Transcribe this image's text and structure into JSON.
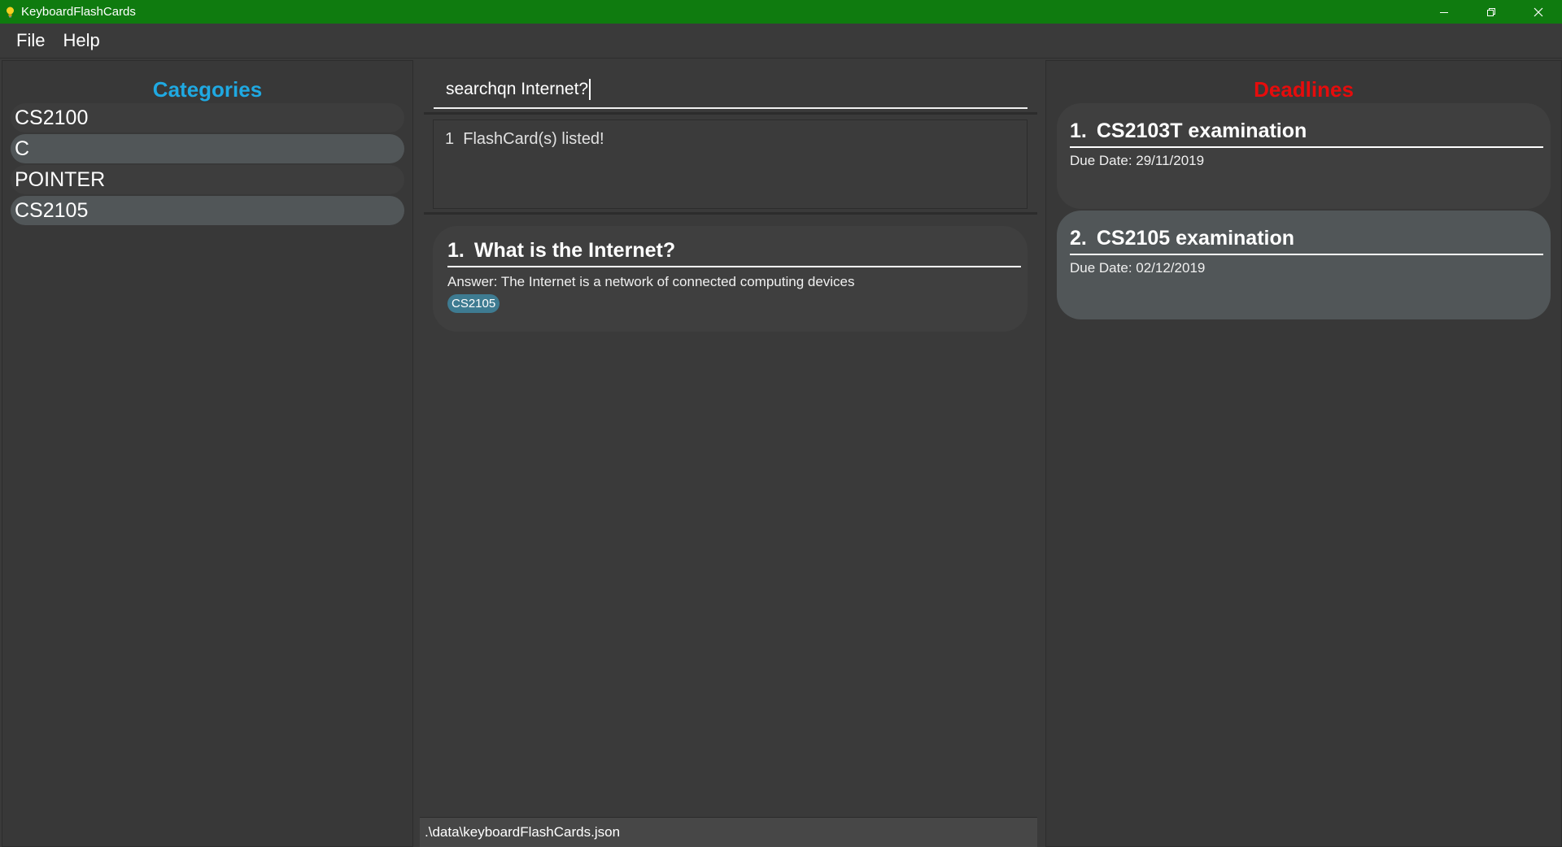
{
  "window": {
    "title": "KeyboardFlashCards",
    "icon": "lightbulb-icon",
    "title_bar_color": "#0f7b0f"
  },
  "menu": {
    "items": [
      {
        "label": "File"
      },
      {
        "label": "Help"
      }
    ]
  },
  "categories": {
    "heading": "Categories",
    "heading_color": "#1fa9e2",
    "items": [
      {
        "label": "CS2100"
      },
      {
        "label": "C"
      },
      {
        "label": "POINTER"
      },
      {
        "label": "CS2105"
      }
    ]
  },
  "command": {
    "value": "searchqn Internet?"
  },
  "result": {
    "message": "1  FlashCard(s) listed!"
  },
  "flashcards": [
    {
      "index": "1.",
      "question": "What is the Internet?",
      "answer": "Answer: The Internet is a network of connected computing devices",
      "tags": [
        "CS2105"
      ]
    }
  ],
  "statusbar": {
    "path": ".\\data\\keyboardFlashCards.json"
  },
  "deadlines": {
    "heading": "Deadlines",
    "heading_color": "#e60c0c",
    "items": [
      {
        "index": "1.",
        "title": "CS2103T examination",
        "due": "Due Date: 29/11/2019"
      },
      {
        "index": "2.",
        "title": "CS2105 examination",
        "due": "Due Date: 02/12/2019"
      }
    ]
  }
}
